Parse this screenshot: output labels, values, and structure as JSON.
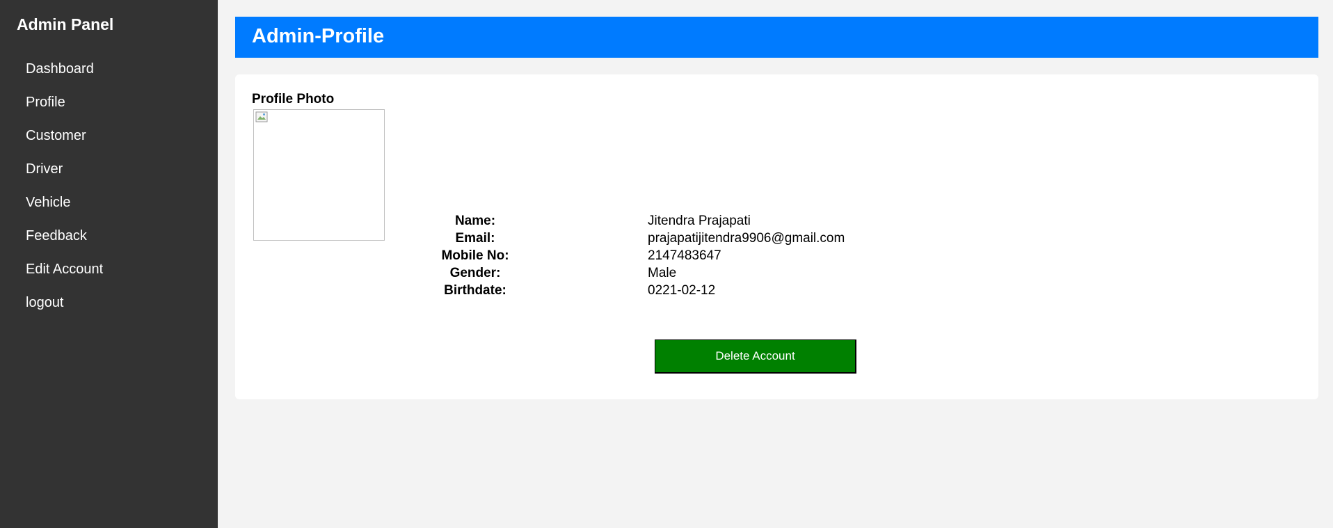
{
  "sidebar": {
    "title": "Admin Panel",
    "items": [
      {
        "label": "Dashboard"
      },
      {
        "label": "Profile"
      },
      {
        "label": "Customer"
      },
      {
        "label": "Driver"
      },
      {
        "label": "Vehicle"
      },
      {
        "label": "Feedback"
      },
      {
        "label": "Edit Account"
      },
      {
        "label": "logout"
      }
    ]
  },
  "header": {
    "title": "Admin-Profile"
  },
  "profile": {
    "photo_label": "Profile Photo",
    "photo_icon": "broken-image-icon",
    "fields": [
      {
        "label": "Name:",
        "value": "Jitendra Prajapati"
      },
      {
        "label": "Email:",
        "value": "prajapatijitendra9906@gmail.com"
      },
      {
        "label": "Mobile No:",
        "value": "2147483647"
      },
      {
        "label": "Gender:",
        "value": "Male"
      },
      {
        "label": "Birthdate:",
        "value": "0221-02-12"
      }
    ],
    "delete_label": "Delete Account"
  },
  "colors": {
    "sidebar_bg": "#333333",
    "header_bg": "#007bff",
    "page_bg": "#f3f3f3",
    "delete_button_bg": "#008000"
  }
}
